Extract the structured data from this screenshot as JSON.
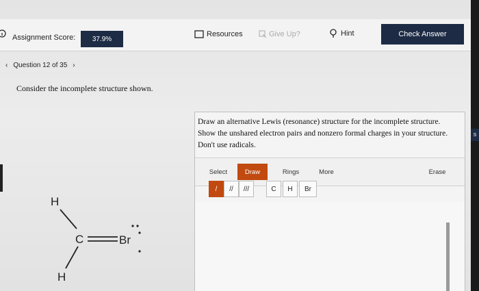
{
  "header": {
    "assignment_score_label": "Assignment Score:",
    "assignment_score_value": "37.9%",
    "resources_label": "Resources",
    "give_up_label": "Give Up?",
    "hint_label": "Hint",
    "check_answer_label": "Check Answer"
  },
  "question_nav": {
    "label": "Question 12 of 35"
  },
  "prompt": "Consider the incomplete structure shown.",
  "panel": {
    "instructions": "Draw an alternative Lewis (resonance) structure for the incomplete structure. Show the unshared electron pairs and nonzero formal charges in your structure. Don't use radicals.",
    "tabs": {
      "select": "Select",
      "draw": "Draw",
      "rings": "Rings",
      "more": "More",
      "erase": "Erase"
    },
    "bond_tools": [
      "/",
      "//",
      "///"
    ],
    "atom_tools": [
      "C",
      "H",
      "Br"
    ]
  },
  "molecule": {
    "atoms": [
      "H",
      "C",
      "Br",
      "H"
    ]
  },
  "side_tab": "S",
  "colors": {
    "navy": "#1d2b45",
    "draw_orange": "#c14a10"
  }
}
